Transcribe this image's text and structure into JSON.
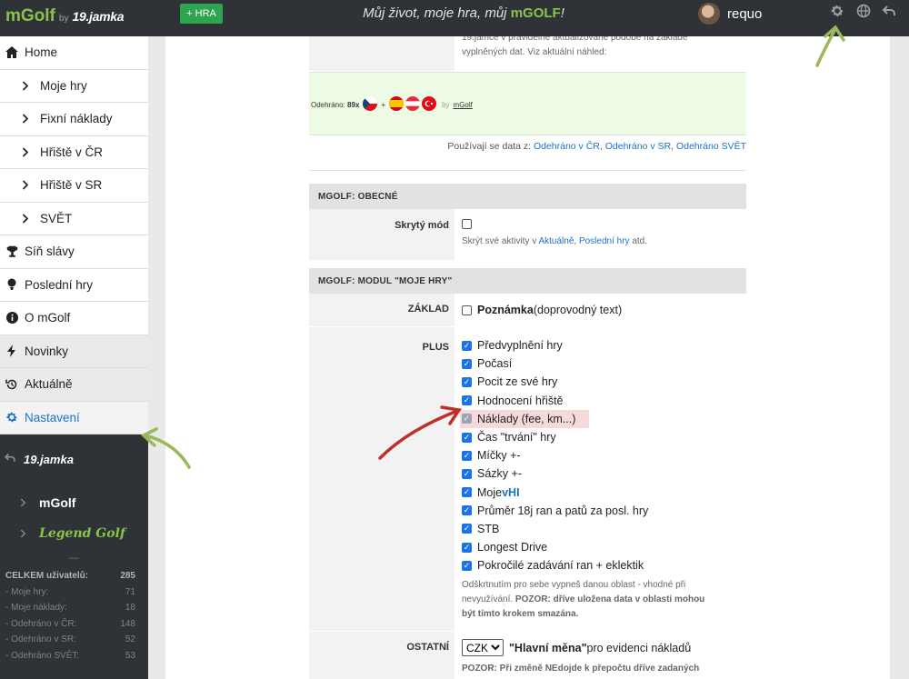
{
  "header": {
    "brand": "mGolf",
    "by": "by",
    "partner": "19.jamka",
    "new_game_button": "+ HRA",
    "motto_pre": "Můj život, moje hra, můj ",
    "motto_brand": "mGOLF",
    "motto_post": "!",
    "username": "requo",
    "icons": [
      "gear-icon",
      "globe-icon",
      "back-icon"
    ]
  },
  "sidebar": {
    "items": [
      {
        "label": "Home",
        "icon": "home-icon"
      },
      {
        "label": "Moje hry",
        "icon": "chevron-right-icon"
      },
      {
        "label": "Fixní náklady",
        "icon": "chevron-right-icon"
      },
      {
        "label": "Hřiště v ČR",
        "icon": "chevron-right-icon"
      },
      {
        "label": "Hřiště v SR",
        "icon": "chevron-right-icon"
      },
      {
        "label": "SVĚT",
        "icon": "chevron-right-icon"
      },
      {
        "label": "Síň slávy",
        "icon": "trophy-icon"
      },
      {
        "label": "Poslední hry",
        "icon": "golf-ball-icon"
      },
      {
        "label": "O mGolf",
        "icon": "info-icon"
      },
      {
        "label": "Novinky",
        "icon": "bolt-icon"
      },
      {
        "label": "Aktuálně",
        "icon": "history-icon"
      },
      {
        "label": "Nastavení",
        "icon": "gear-icon"
      }
    ],
    "partners": [
      "19.jamka",
      "mGolf",
      "Legend Golf"
    ],
    "sep": "—",
    "stats": [
      {
        "label": "CELKEM uživatelů:",
        "value": "285"
      },
      {
        "label": "- Moje hry:",
        "value": "71"
      },
      {
        "label": "- Moje náklady:",
        "value": "18"
      },
      {
        "label": "- Odehráno v ČR:",
        "value": "148"
      },
      {
        "label": "- Odehráno v SR:",
        "value": "52"
      },
      {
        "label": "- Odehráno SVĚT:",
        "value": "53"
      }
    ]
  },
  "main": {
    "top_note_1": "19.jamce v pravidelně aktualizované podobě na základě",
    "top_note_2": "vyplněných dat. Viz aktuální náhled:",
    "preview": {
      "prefix": "Odehráno:",
      "count": "89x",
      "plus": "+",
      "by": "by",
      "brand": "mGolf"
    },
    "data_source": {
      "prefix": "Používají se data z: ",
      "links": [
        "Odehráno v ČR",
        "Odehráno v SR",
        "Odehráno SVĚT"
      ]
    },
    "section_general": "MGOLF: OBECNÉ",
    "hidden_mode": {
      "label": "Skrytý mód",
      "note_pre": "Skrýt své aktivity v ",
      "link1": "Aktuálně",
      "link2": "Poslední hry",
      "note_post": " atd."
    },
    "section_module": "MGOLF: MODUL \"MOJE HRY\"",
    "zaklad": {
      "label": "ZÁKLAD",
      "item_bold": "Poznámka",
      "item_rest": " (doprovodný text)"
    },
    "plus": {
      "label": "PLUS",
      "items": [
        {
          "label": "Předvyplnění hry"
        },
        {
          "label": "Počasí"
        },
        {
          "label": "Pocit ze své hry"
        },
        {
          "label": "Hodnocení hřiště"
        },
        {
          "label": "Náklady (fee, km...)"
        },
        {
          "label": "Čas \"trvání\" hry"
        },
        {
          "label": "Míčky +-"
        },
        {
          "label": "Sázky +-"
        },
        {
          "label": "Moje ",
          "extra": "vHI"
        },
        {
          "label": "Průměr 18j ran a patů za posl. hry"
        },
        {
          "label": "STB"
        },
        {
          "label": "Longest Drive"
        },
        {
          "label": "Pokročilé zadávání ran + eklektik"
        }
      ],
      "note_1": "Odškrtnutím pro sebe vypneš danou oblast - vhodné při",
      "note_2_pre": "nevyužívání. ",
      "note_2_bold": "POZOR: dříve uložena data v oblasti mohou",
      "note_3_bold": "být tímto krokem smazána."
    },
    "ostatni": {
      "label": "OSTATNÍ",
      "currency_value": "CZK",
      "main_currency_bold": "\"Hlavní měna\"",
      "main_currency_rest": " pro evidenci nákladů",
      "note_bold": "POZOR:",
      "note_rest": " Při změně NEdojde k přepočtu dříve zadaných"
    }
  },
  "colors": {
    "accent": "#1a73c9",
    "brand_green": "#8bc34a",
    "topbar": "#2f3337",
    "hra_button": "#2ea44f",
    "annotation_red": "#c0302a",
    "annotation_green": "#9bb85a"
  }
}
